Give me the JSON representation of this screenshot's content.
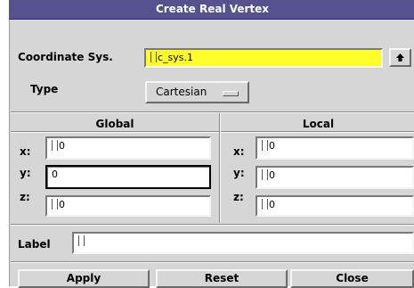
{
  "window": {
    "title": "Create Real Vertex"
  },
  "coordinate_sys": {
    "label": "Coordinate Sys.",
    "value": "c_sys.1",
    "arrow_icon": "arrow-up-icon"
  },
  "type": {
    "label": "Type",
    "selected": "Cartesian"
  },
  "global": {
    "header": "Global",
    "x": {
      "label": "x:",
      "value": "0"
    },
    "y": {
      "label": "y:",
      "value": "0"
    },
    "z": {
      "label": "z:",
      "value": "0"
    }
  },
  "local": {
    "header": "Local",
    "x": {
      "label": "x:",
      "value": "0"
    },
    "y": {
      "label": "y:",
      "value": "0"
    },
    "z": {
      "label": "z:",
      "value": "0"
    }
  },
  "label_field": {
    "label": "Label",
    "value": ""
  },
  "buttons": {
    "apply": "Apply",
    "reset": "Reset",
    "close": "Close"
  },
  "colors": {
    "title_bar": "#56528f",
    "highlight_field": "#ffff28",
    "panel": "#d6d6d6"
  }
}
